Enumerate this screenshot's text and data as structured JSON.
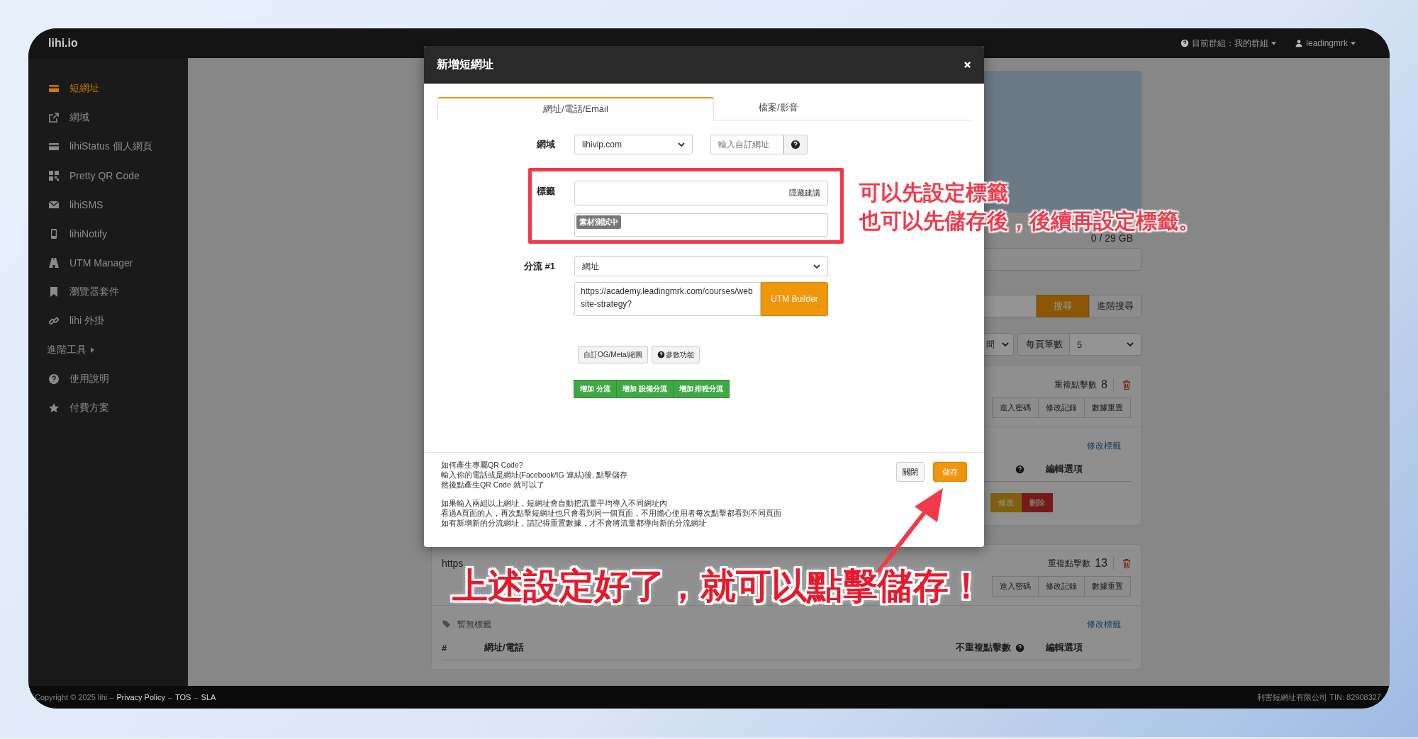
{
  "top_bar": {
    "logo": "lihi.io",
    "group": "目前群組：我的群組",
    "user": "leadingmrk"
  },
  "sidebar": {
    "items": [
      {
        "label": "短網址",
        "kind": "link",
        "selected": true
      },
      {
        "label": "網域",
        "kind": "link",
        "selected": false
      },
      {
        "label": "lihiStatus 個人網頁",
        "kind": "link",
        "selected": false
      },
      {
        "label": "Pretty QR Code",
        "kind": "link",
        "selected": false
      },
      {
        "label": "lihiSMS",
        "kind": "link",
        "selected": false
      },
      {
        "label": "lihiNotify",
        "kind": "link",
        "selected": false
      },
      {
        "label": "UTM Manager",
        "kind": "link",
        "selected": false
      },
      {
        "label": "瀏覽器套件",
        "kind": "link",
        "selected": false
      },
      {
        "label": "lihi 外掛",
        "kind": "link",
        "selected": false
      },
      {
        "label": "進階工具",
        "kind": "section",
        "selected": false
      },
      {
        "label": "使用說明",
        "kind": "link",
        "selected": false
      },
      {
        "label": "付費方案",
        "kind": "link",
        "selected": false
      }
    ]
  },
  "main": {
    "storage": "0 / 29 GB",
    "search_button": "搜尋",
    "advanced_search_button": "進階搜尋",
    "sort_select": "間",
    "per_page_label": "每頁筆數",
    "per_page_select": "5",
    "cards": [
      {
        "repeat_label": "重複點擊數",
        "repeat_count": "8",
        "buttons": [
          "進入密碼",
          "修改記錄",
          "數據重置"
        ],
        "edit_tags": "修改標籤",
        "columns": [
          {
            "help": true
          },
          {
            "label": "編輯選項",
            "help": false
          }
        ],
        "row_buttons": [
          {
            "label": "修改",
            "kind": "edit"
          },
          {
            "label": "刪除",
            "kind": "delete"
          }
        ]
      },
      {
        "title": "https",
        "repeat_label": "重複點擊數",
        "repeat_count": "13",
        "buttons": [
          "進入密碼",
          "修改記錄",
          "數據重置"
        ],
        "tag_text": "暫無標籤",
        "edit_tags": "修改標籤",
        "columns": [
          {
            "label": "#",
            "help": false
          },
          {
            "label": "網址/電話",
            "help": false
          },
          {
            "label": "不重複點擊數",
            "help": true
          },
          {
            "label": "編輯選項",
            "help": false
          }
        ]
      }
    ]
  },
  "modal": {
    "title": "新增短網址",
    "tabs": [
      {
        "label": "網址/電話/Email",
        "selected": true
      },
      {
        "label": "檔案/影音",
        "selected": false
      }
    ],
    "domain": {
      "label": "網域",
      "select": "lihivip.com",
      "custom_placeholder": "輸入自訂網址"
    },
    "tags": {
      "label": "標籤",
      "hide_suggestions": "隱藏建議",
      "tags": [
        "素材測試中"
      ]
    },
    "split": {
      "label": "分流 #1",
      "select": "網址",
      "url": "https://academy.leadingmrk.com/courses/website-strategy?",
      "utm_button": "UTM Builder"
    },
    "option_buttons": [
      {
        "label": "自訂OG/Meta/縮圖",
        "kind": "plain"
      },
      {
        "label": "參數功能",
        "kind": "help"
      }
    ],
    "add_buttons": [
      "增加 分流",
      "增加 設備分流",
      "增加 排程分流"
    ],
    "help_paragraphs": [
      [
        "如何產生專屬QR Code?",
        "輸入你的電話或是網址(Facebook/IG 連結)後, 點擊儲存",
        "然後點產生QR Code 就可以了"
      ],
      [
        "如果輸入兩組以上網址，短網址會自動把流量平均導入不同網址內",
        "看過A頁面的人，再次點擊短網址也只會看到同一個頁面，不用擔心使用者每次點擊都看到不同頁面",
        "如有新增新的分流網址，請記得重置數據，才不會將流量都導向新的分流網址"
      ]
    ],
    "close_button": "關閉",
    "save_button": "儲存"
  },
  "annotations": {
    "callout": [
      "可以先設定標籤",
      "也可以先儲存後，後續再設定標籤。"
    ],
    "caption": "上述設定好了，就可以點擊儲存！"
  },
  "footer": {
    "copyright": "Copyright © 2025 lihi –",
    "links": [
      "Privacy Policy",
      "TOS",
      "SLA"
    ],
    "separator": "–",
    "company": "利害短網址有限公司 TIN: 82908327"
  }
}
